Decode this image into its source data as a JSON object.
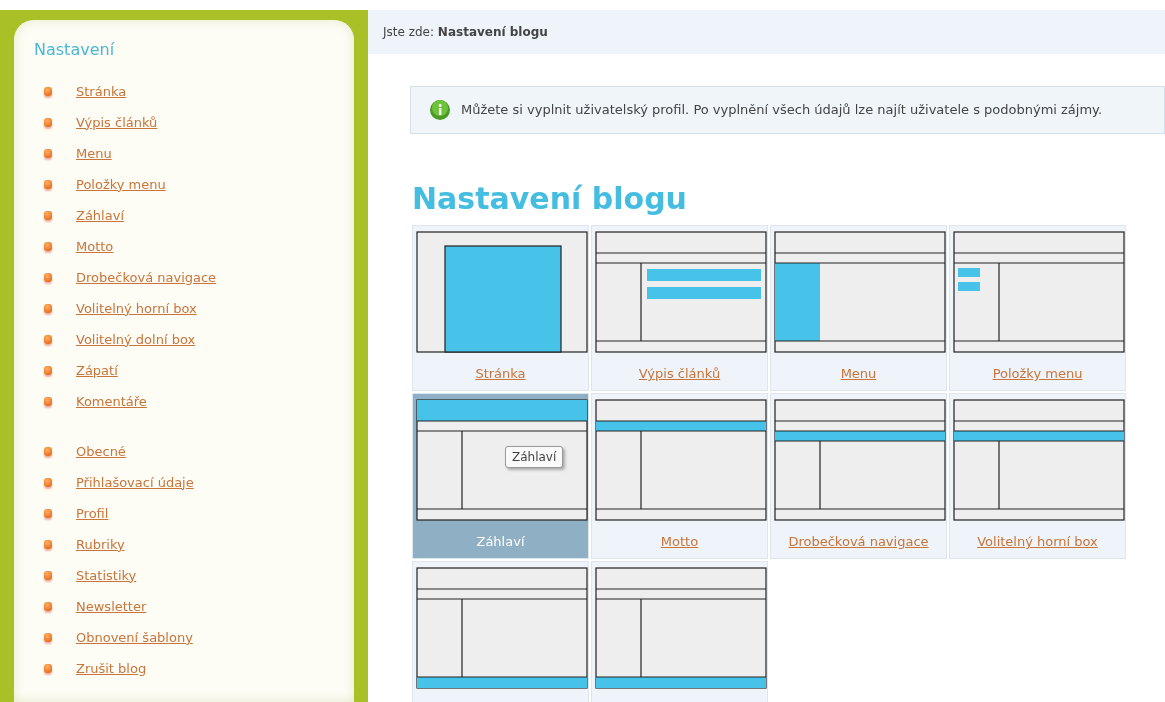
{
  "sidebar": {
    "title": "Nastavení",
    "groups": [
      {
        "items": [
          "Stránka",
          "Výpis článků",
          "Menu",
          "Položky menu",
          "Záhlaví",
          "Motto",
          "Drobečková navigace",
          "Volitelný horní box",
          "Volitelný dolní box",
          "Zápatí",
          "Komentáře"
        ]
      },
      {
        "items": [
          "Obecné",
          "Přihlašovací údaje",
          "Profil",
          "Rubriky",
          "Statistiky",
          "Newsletter",
          "Obnovení šablony",
          "Zrušit blog"
        ]
      }
    ]
  },
  "breadcrumb": "Jste zde: **Nastavení blogu**",
  "notice": "Můžete si vyplnit uživatelský profil. Po vyplnění všech údajů lze najít uživatele s podobnými zájmy.",
  "heading": "Nastavení blogu",
  "tiles": [
    {
      "label": "Stránka",
      "kind": "page",
      "selected": false
    },
    {
      "label": "Výpis článků",
      "kind": "list",
      "selected": false
    },
    {
      "label": "Menu",
      "kind": "side",
      "selected": false
    },
    {
      "label": "Položky menu",
      "kind": "items",
      "selected": false
    },
    {
      "label": "Záhlaví",
      "kind": "top",
      "selected": true,
      "tooltip": "Záhlaví"
    },
    {
      "label": "Motto",
      "kind": "second",
      "selected": false
    },
    {
      "label": "Drobečková navigace",
      "kind": "third",
      "selected": false
    },
    {
      "label": "Volitelný horní box",
      "kind": "third",
      "selected": false
    },
    {
      "kind": "bottom",
      "selected": false
    },
    {
      "kind": "bottom",
      "selected": false
    }
  ]
}
